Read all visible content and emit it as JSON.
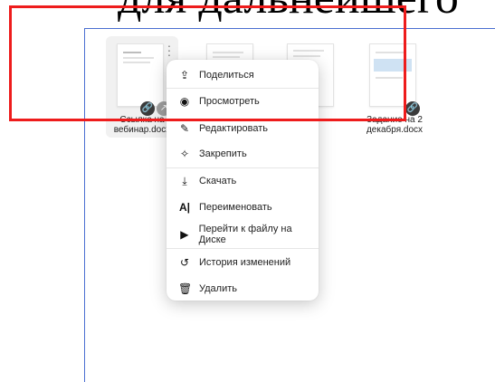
{
  "heading": {
    "text": "для дальнейшего"
  },
  "files": [
    {
      "name_line1": "Ссылка на",
      "name_line2": "вебинар.docx"
    },
    {
      "name_line1": "",
      "name_line2": ""
    },
    {
      "name_line1": "",
      "name_line2": ""
    },
    {
      "name_line1": "Задание на 2",
      "name_line2": "декабря.docx"
    }
  ],
  "context_menu": {
    "items": [
      {
        "label": "Поделиться",
        "icon": "share-icon"
      },
      {
        "label": "Просмотреть",
        "icon": "eye-icon"
      },
      {
        "label": "Редактировать",
        "icon": "pencil-icon"
      },
      {
        "label": "Закрепить",
        "icon": "pin-icon"
      },
      {
        "label": "Скачать",
        "icon": "download-icon"
      },
      {
        "label": "Переименовать",
        "icon": "rename-icon"
      },
      {
        "label": "Перейти к файлу на Диске",
        "icon": "go-to-file-icon"
      },
      {
        "label": "История изменений",
        "icon": "history-icon"
      },
      {
        "label": "Удалить",
        "icon": "trash-icon"
      }
    ]
  },
  "colors": {
    "annotation_red": "#ee1c1c",
    "frame_blue": "#4a6fd1",
    "badge_dark": "#3b3b3b"
  }
}
